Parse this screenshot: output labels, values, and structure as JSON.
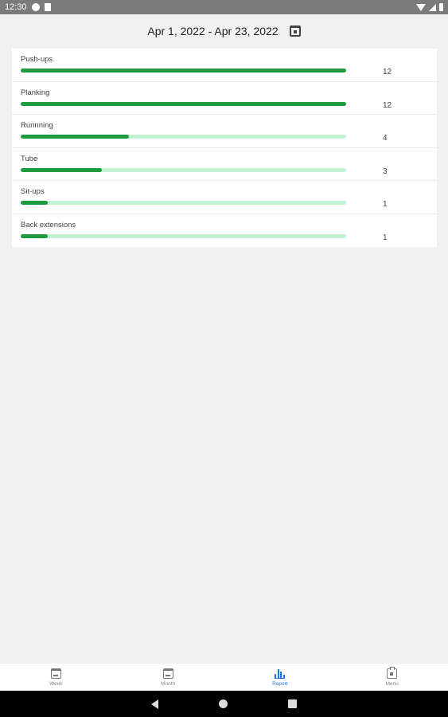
{
  "status_bar": {
    "time": "12:30"
  },
  "header": {
    "date_range": "Apr 1, 2022 - Apr 23, 2022"
  },
  "exercises": [
    {
      "name": "Push-ups",
      "count": "12",
      "progress": 1.0
    },
    {
      "name": "Planking",
      "count": "12",
      "progress": 1.0
    },
    {
      "name": "Runnning",
      "count": "4",
      "progress": 0.333
    },
    {
      "name": "Tube",
      "count": "3",
      "progress": 0.25
    },
    {
      "name": "Sit-ups",
      "count": "1",
      "progress": 0.083
    },
    {
      "name": "Back extensions",
      "count": "1",
      "progress": 0.083
    }
  ],
  "bottom_nav": [
    {
      "label": "Week",
      "icon": "calendar-icon"
    },
    {
      "label": "Month",
      "icon": "calendar-icon"
    },
    {
      "label": "Report",
      "icon": "bar-chart-icon",
      "active": true
    },
    {
      "label": "Menu",
      "icon": "clipboard-icon"
    }
  ],
  "colors": {
    "bar_fill": "#1f9a3e",
    "bar_track": "#c1f2d1",
    "accent": "#1a73e8",
    "status_bar": "#7b7b7b"
  }
}
